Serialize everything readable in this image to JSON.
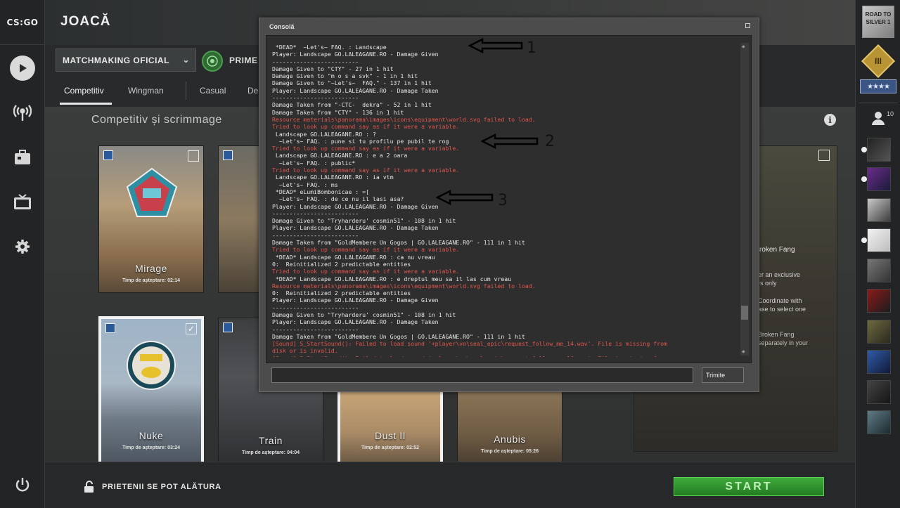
{
  "app": {
    "logo_text": "CS:GO",
    "title": "JOACĂ"
  },
  "left_nav": {
    "icons": [
      "play-icon",
      "broadcast-icon",
      "inventory-icon",
      "tv-icon",
      "gear-icon",
      "power-icon"
    ]
  },
  "matchmaking": {
    "mode_select": "MATCHMAKING OFICIAL",
    "prime_label": "PRIME A",
    "tabs": [
      "Competitiv",
      "Wingman",
      "Casual",
      "Dea"
    ]
  },
  "section": {
    "title": "Competitiv și scrimmage"
  },
  "maps": [
    {
      "name": "Mirage",
      "wait": "Timp de așteptare: 02:14",
      "selected": false
    },
    {
      "name": "",
      "wait": "",
      "selected": false
    },
    {
      "name": "Nuke",
      "wait": "Timp de așteptare: 03:24",
      "selected": true
    },
    {
      "name": "Train",
      "wait": "Timp de așteptare: 04:04",
      "selected": false
    },
    {
      "name": "Dust II",
      "wait": "Timp de așteptare: 02:52",
      "selected": true
    },
    {
      "name": "Anubis",
      "wait": "Timp de așteptare: 05:26",
      "selected": false
    }
  ],
  "mirage_badge": "MIRAGE",
  "broken_fang": {
    "title": "roken Fang",
    "text1": "er an exclusive\nrs only",
    "text2": "Coordinate with\nase to select one",
    "text3": "Broken Fang\nseparately in your"
  },
  "footer": {
    "friends_label": "PRIETENII SE POT ALĂTURA",
    "start_label": "START"
  },
  "right_bar": {
    "rank_text": "ROAD TO SILVER 1",
    "level": "III",
    "stars": "★★★★",
    "friends_count": "10"
  },
  "console": {
    "title": "Consolă",
    "submit_label": "Trimite",
    "lines": [
      {
        "t": " *DEAD*  ~Let's~ FAQ. : Landscape",
        "err": false
      },
      {
        "t": "Player: Landscape GO.LALEAGANE.RO - Damage Given",
        "err": false
      },
      {
        "t": "-------------------------",
        "err": false
      },
      {
        "t": "Damage Given to \"CTY\" - 27 in 1 hit",
        "err": false
      },
      {
        "t": "Damage Given to \"m o s a svk\" - 1 in 1 hit",
        "err": false
      },
      {
        "t": "Damage Given to \"~Let's~  FAQ.\" - 137 in 1 hit",
        "err": false
      },
      {
        "t": "Player: Landscape GO.LALEAGANE.RO - Damage Taken",
        "err": false
      },
      {
        "t": "-------------------------",
        "err": false
      },
      {
        "t": "Damage Taken from \"-CTC-  dekra\" - 52 in 1 hit",
        "err": false
      },
      {
        "t": "Damage Taken from \"CTY\" - 136 in 1 hit",
        "err": false
      },
      {
        "t": "Resource materials\\panorama\\images\\icons\\equipment\\world.svg failed to load.",
        "err": true
      },
      {
        "t": "Tried to look up command say as if it were a variable.",
        "err": true
      },
      {
        "t": " Landscape GO.LALEAGANE.RO : ?",
        "err": false
      },
      {
        "t": "  ~Let's~ FAQ. : pune si tu profilu pe pubil te rog",
        "err": false
      },
      {
        "t": "Tried to look up command say as if it were a variable.",
        "err": true
      },
      {
        "t": " Landscape GO.LALEAGANE.RO : e a 2 oara",
        "err": false
      },
      {
        "t": "  ~Let's~ FAQ. : public*",
        "err": false
      },
      {
        "t": "Tried to look up command say as if it were a variable.",
        "err": true
      },
      {
        "t": " Landscape GO.LALEAGANE.RO : ia vtm",
        "err": false
      },
      {
        "t": "  ~Let's~ FAQ. : ms",
        "err": false
      },
      {
        "t": " *DEAD* eLumiBombonicae : =[",
        "err": false
      },
      {
        "t": "  ~Let's~ FAQ. : de ce nu il lasi asa?",
        "err": false
      },
      {
        "t": "Player: Landscape GO.LALEAGANE.RO - Damage Given",
        "err": false
      },
      {
        "t": "-------------------------",
        "err": false
      },
      {
        "t": "Damage Given to \"Tryharderu' cosmin51\" - 108 in 1 hit",
        "err": false
      },
      {
        "t": "Player: Landscape GO.LALEAGANE.RO - Damage Taken",
        "err": false
      },
      {
        "t": "-------------------------",
        "err": false
      },
      {
        "t": "Damage Taken from \"GoldMembere Un Gogos | GO.LALEAGANE.RO\" - 111 in 1 hit",
        "err": false
      },
      {
        "t": "Tried to look up command say as if it were a variable.",
        "err": true
      },
      {
        "t": " *DEAD* Landscape GO.LALEAGANE.RO : ca nu vreau",
        "err": false
      },
      {
        "t": "0:  Reinitialized 2 predictable entities",
        "err": false
      },
      {
        "t": "Tried to look up command say as if it were a variable.",
        "err": true
      },
      {
        "t": " *DEAD* Landscape GO.LALEAGANE.RO : e dreptul meu sa il las cum vreau",
        "err": false
      },
      {
        "t": "Resource materials\\panorama\\images\\icons\\equipment\\world.svg failed to load.",
        "err": true
      },
      {
        "t": "0:  Reinitialized 2 predictable entities",
        "err": false
      },
      {
        "t": "Player: Landscape GO.LALEAGANE.RO - Damage Given",
        "err": false
      },
      {
        "t": "-------------------------",
        "err": false
      },
      {
        "t": "Damage Given to \"Tryharderu' cosmin51\" - 108 in 1 hit",
        "err": false
      },
      {
        "t": "Player: Landscape GO.LALEAGANE.RO - Damage Taken",
        "err": false
      },
      {
        "t": "-------------------------",
        "err": false
      },
      {
        "t": "Damage Taken from \"GoldMembere Un Gogos | GO.LALEAGANE.RO\" - 111 in 1 hit",
        "err": false
      },
      {
        "t": "[Sound] S_StartSound(): Failed to load sound '+player\\vo\\seal_epic\\request_follow_me_14.wav'. File is missing from",
        "err": true
      },
      {
        "t": "disk or is invalid.",
        "err": true
      },
      {
        "t": "[Sound] S_StartSound(): Failed to load sound '+player\\vo\\seal_epic\\request_follow_me_14.wav'. File is missing from",
        "err": true
      }
    ]
  },
  "annotations": [
    "1",
    "2",
    "3"
  ]
}
